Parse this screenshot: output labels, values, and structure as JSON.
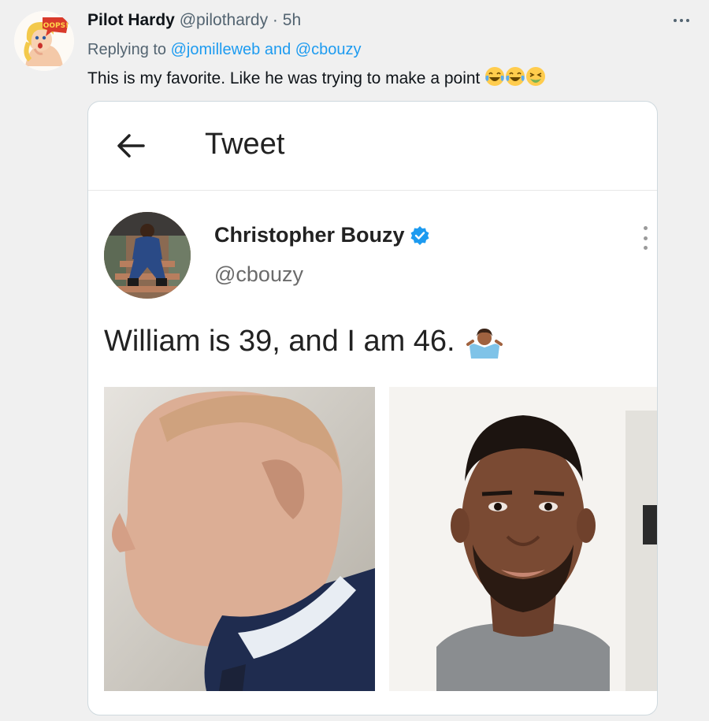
{
  "reply": {
    "author_name": "Pilot Hardy",
    "author_handle": "@pilothardy",
    "separator": "·",
    "time": "5h",
    "replying_prefix": "Replying to",
    "mention_1": "@jomilleweb",
    "replying_and": "and",
    "mention_2": "@cbouzy",
    "text": "This is my favorite. Like he was trying to make a point",
    "emojis": [
      "face-with-tears-of-joy",
      "face-with-tears-of-joy",
      "nauseated-face"
    ],
    "avatar_badge": "OOPS!"
  },
  "embedded_tweet": {
    "header_title": "Tweet",
    "author_name": "Christopher Bouzy",
    "author_handle": "@cbouzy",
    "verified": true,
    "text": "William is 39, and I am 46.",
    "emoji": "person-shrugging",
    "photos": [
      "photo-left",
      "photo-right"
    ]
  },
  "colors": {
    "page_bg": "#f0f0f0",
    "link_blue": "#1d9bf0",
    "muted": "#536471",
    "verified_blue": "#1d9bf0"
  }
}
